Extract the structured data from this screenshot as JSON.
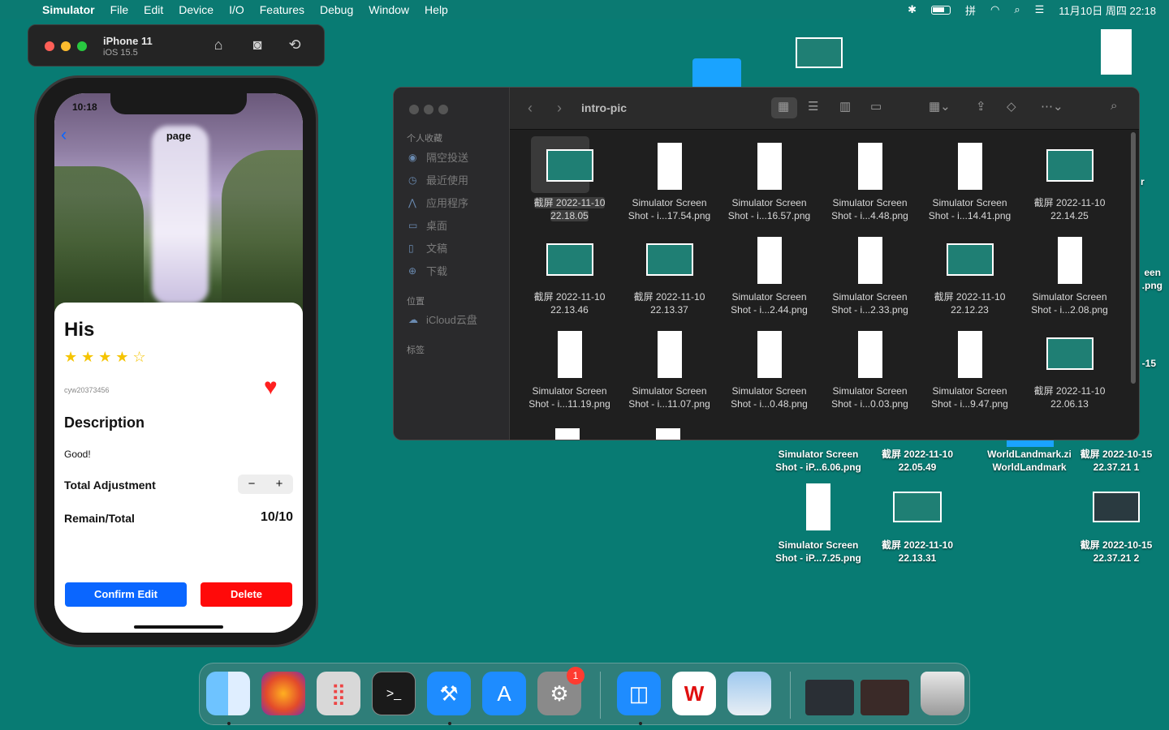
{
  "menubar": {
    "app": "Simulator",
    "items": [
      "File",
      "Edit",
      "Device",
      "I/O",
      "Features",
      "Debug",
      "Window",
      "Help"
    ],
    "clock": "11月10日 周四 22:18"
  },
  "simulator": {
    "device": "iPhone 11",
    "os": "iOS 15.5"
  },
  "phone": {
    "time": "10:18",
    "nav_title": "page",
    "title": "His",
    "rating_stars": 4,
    "rating_max": 5,
    "stars_text": "★★★★☆",
    "user_id": "cyw20373456",
    "description_heading": "Description",
    "description": "Good!",
    "adjust_label": "Total Adjustment",
    "minus": "−",
    "plus": "+",
    "remain_label": "Remain/Total",
    "remain_value": "10/10",
    "confirm_label": "Confirm Edit",
    "delete_label": "Delete"
  },
  "finder": {
    "folder": "intro-pic",
    "sidebar": {
      "favorites_heading": "个人收藏",
      "favorites": [
        {
          "label": "隔空投送",
          "icon": "airdrop-icon"
        },
        {
          "label": "最近使用",
          "icon": "clock-icon"
        },
        {
          "label": "应用程序",
          "icon": "applications-icon"
        },
        {
          "label": "桌面",
          "icon": "desktop-icon"
        },
        {
          "label": "文稿",
          "icon": "document-icon"
        },
        {
          "label": "下载",
          "icon": "download-icon"
        }
      ],
      "locations_heading": "位置",
      "locations": [
        {
          "label": "iCloud云盘",
          "icon": "cloud-icon"
        }
      ],
      "tags_heading": "标签"
    },
    "files": [
      {
        "l1": "截屏 2022-11-10",
        "l2": "22.18.05",
        "kind": "land",
        "selected": true
      },
      {
        "l1": "Simulator Screen",
        "l2": "Shot - i...17.54.png",
        "kind": "port"
      },
      {
        "l1": "Simulator Screen",
        "l2": "Shot - i...16.57.png",
        "kind": "port"
      },
      {
        "l1": "Simulator Screen",
        "l2": "Shot - i...4.48.png",
        "kind": "port"
      },
      {
        "l1": "Simulator Screen",
        "l2": "Shot - i...14.41.png",
        "kind": "port"
      },
      {
        "l1": "截屏 2022-11-10",
        "l2": "22.14.25",
        "kind": "land"
      },
      {
        "l1": "截屏 2022-11-10",
        "l2": "22.13.46",
        "kind": "land"
      },
      {
        "l1": "截屏 2022-11-10",
        "l2": "22.13.37",
        "kind": "land"
      },
      {
        "l1": "Simulator Screen",
        "l2": "Shot - i...2.44.png",
        "kind": "port"
      },
      {
        "l1": "Simulator Screen",
        "l2": "Shot - i...2.33.png",
        "kind": "port"
      },
      {
        "l1": "截屏 2022-11-10",
        "l2": "22.12.23",
        "kind": "land"
      },
      {
        "l1": "Simulator Screen",
        "l2": "Shot - i...2.08.png",
        "kind": "port"
      },
      {
        "l1": "Simulator Screen",
        "l2": "Shot - i...11.19.png",
        "kind": "port"
      },
      {
        "l1": "Simulator Screen",
        "l2": "Shot - i...11.07.png",
        "kind": "port"
      },
      {
        "l1": "Simulator Screen",
        "l2": "Shot - i...0.48.png",
        "kind": "port"
      },
      {
        "l1": "Simulator Screen",
        "l2": "Shot - i...0.03.png",
        "kind": "port"
      },
      {
        "l1": "Simulator Screen",
        "l2": "Shot - i...9.47.png",
        "kind": "port"
      },
      {
        "l1": "截屏 2022-11-10",
        "l2": "22.06.13",
        "kind": "land"
      }
    ]
  },
  "desktop": {
    "partial_right_1": "r",
    "partial_right_2a": "een",
    "partial_right_2b": ".png",
    "partial_right_3": "-15",
    "items": [
      {
        "l1": "Simulator Screen",
        "l2": "Shot - iP...6.06.png"
      },
      {
        "l1": "截屏 2022-11-10",
        "l2": "22.05.49"
      },
      {
        "l1": "WorldLandmark.zi",
        "l2": "WorldLandmark"
      },
      {
        "l1": "截屏 2022-10-15",
        "l2": "22.37.21 1"
      },
      {
        "l1": "Simulator Screen",
        "l2": "Shot - iP...7.25.png"
      },
      {
        "l1": "截屏 2022-11-10",
        "l2": "22.13.31"
      },
      {
        "l1": "截屏 2022-10-15",
        "l2": "22.37.21 2"
      }
    ]
  },
  "dock": {
    "apps": [
      "Finder",
      "Firefox",
      "Launchpad",
      "Terminal",
      "Xcode",
      "App Store",
      "System Preferences",
      "Simulator",
      "WPS",
      "Preview"
    ],
    "badge": "1"
  },
  "colors": {
    "desktop": "#087b73",
    "accent": "#0a66ff",
    "delete": "#ff0a0a",
    "star": "#f5c400"
  }
}
